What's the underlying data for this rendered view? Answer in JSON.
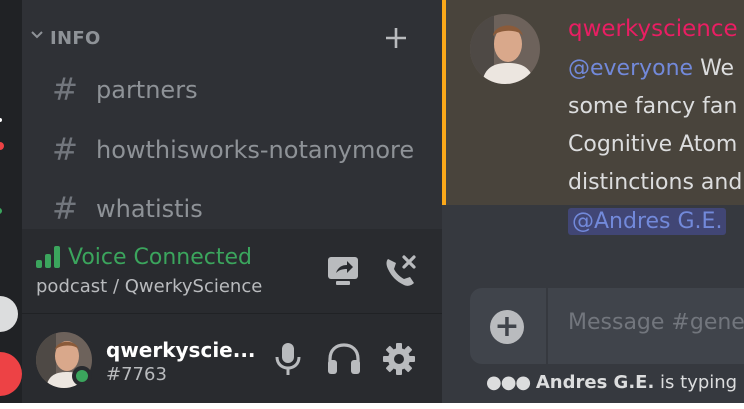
{
  "category": {
    "label": "INFO"
  },
  "channels": [
    {
      "hash": "#",
      "name": "partners"
    },
    {
      "hash": "#",
      "name": "howthisworks-notanymore"
    },
    {
      "hash": "#",
      "name": "whatistis"
    }
  ],
  "voice": {
    "status": "Voice Connected",
    "channel": "podcast / QwerkyScience"
  },
  "user": {
    "name": "qwerkyscie...",
    "discriminator": "#7763"
  },
  "message": {
    "author": "qwerkyscience",
    "mention": "@everyone",
    "line1_rest": " We",
    "line2": "some fancy fan",
    "line3": "Cognitive Atom",
    "line4": "distinctions and",
    "mention_user": "@Andres G.E."
  },
  "composer": {
    "plus": "+",
    "placeholder": "Message #gene"
  },
  "typing": {
    "dots": "●●●",
    "user": "Andres G.E.",
    "suffix": " is typing"
  },
  "colors": {
    "online": "#3ba55d",
    "author": "#e91e63",
    "mention": "#7289da",
    "highlight_border": "#faa81a"
  }
}
